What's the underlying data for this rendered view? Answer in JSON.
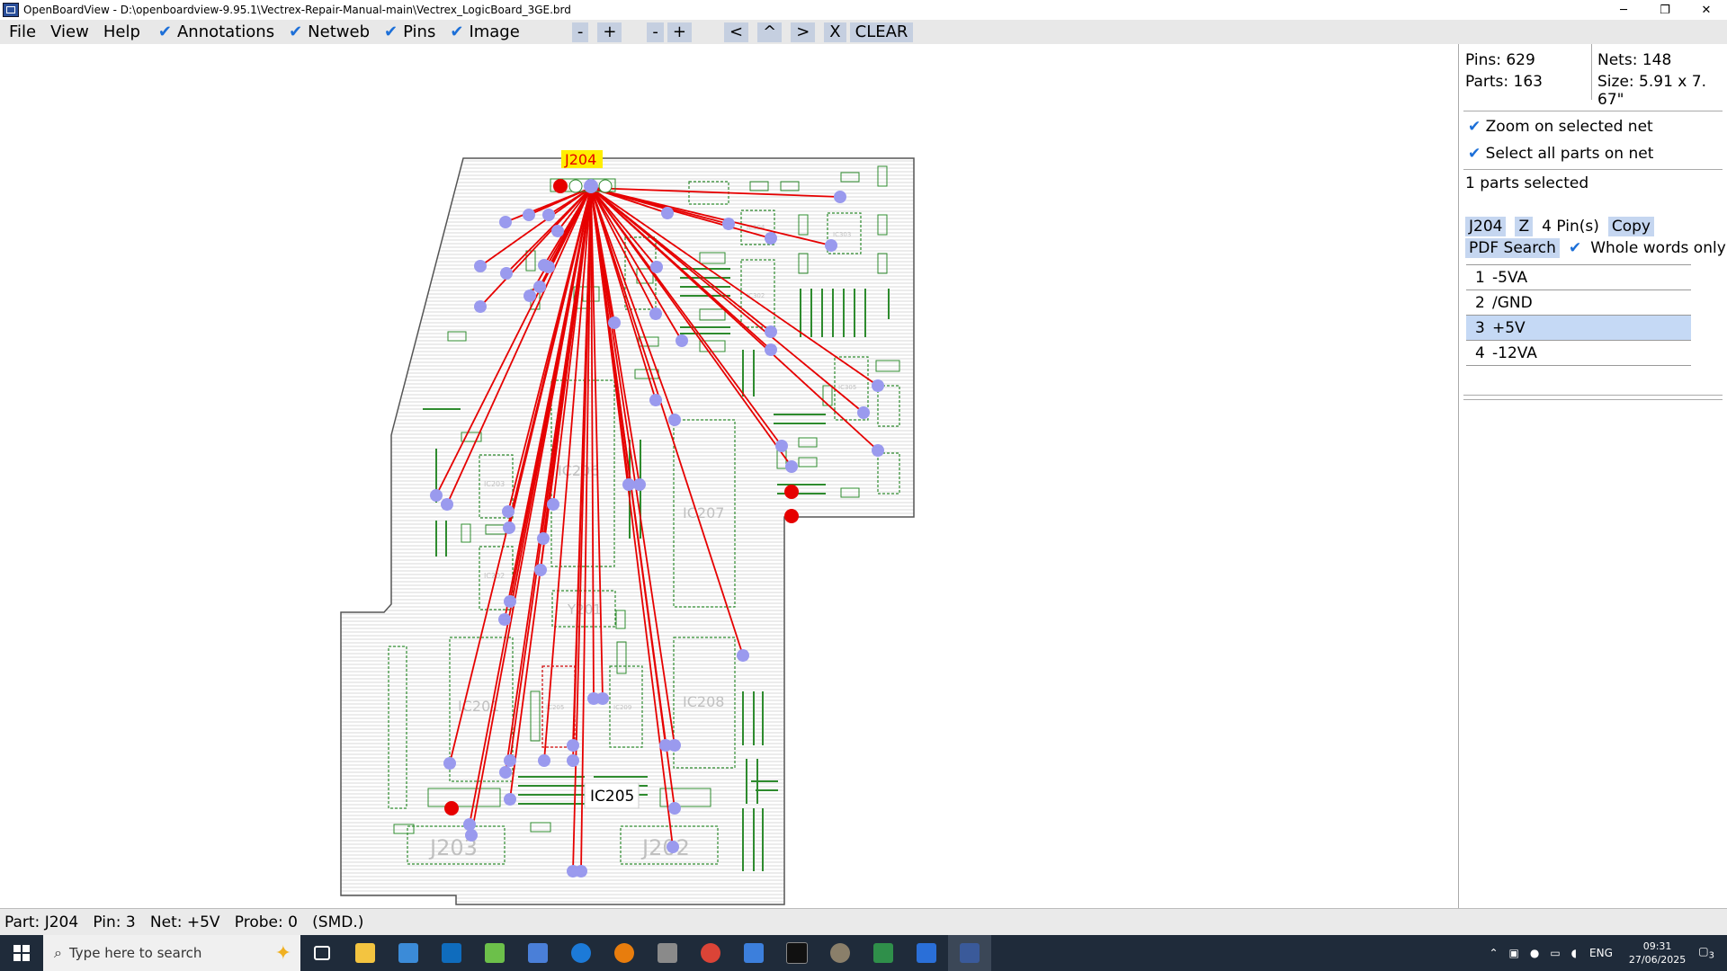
{
  "window": {
    "title": "OpenBoardView - D:\\openboardview-9.95.1\\Vectrex-Repair-Manual-main\\Vectrex_LogicBoard_3GE.brd",
    "minimize_glyph": "─",
    "restore_glyph": "❐",
    "close_glyph": "✕"
  },
  "menu": {
    "file": "File",
    "view": "View",
    "help": "Help",
    "check_glyph": "✔",
    "annotations": "Annotations",
    "netweb": "Netweb",
    "pins": "Pins",
    "image": "Image",
    "zoom_out": "-",
    "zoom_in": "+",
    "rot_minus": "-",
    "rot_plus": "+",
    "nav_left": "<",
    "nav_up": "^",
    "nav_right": ">",
    "nav_x": "X",
    "clear": "CLEAR"
  },
  "panel": {
    "pins": "Pins: 629",
    "nets": "Nets: 148",
    "parts": "Parts: 163",
    "size": "Size: 5.91 x 7.",
    "size2": "67\"",
    "zoom_net": "Zoom on selected net",
    "select_all": "Select all parts on net",
    "selected_count": "1 parts selected",
    "part_name": "J204",
    "z_button": "Z",
    "pin_count": "4 Pin(s)",
    "copy": "Copy",
    "pdf_search": "PDF Search",
    "whole_words": "Whole words only",
    "pin_rows": [
      {
        "num": "1",
        "net": "-5VA"
      },
      {
        "num": "2",
        "net": "/GND"
      },
      {
        "num": "3",
        "net": "+5V"
      },
      {
        "num": "4",
        "net": "-12VA"
      }
    ]
  },
  "board": {
    "selected_label": "J204",
    "hover_label": "IC205",
    "part_labels": [
      "IC206",
      "IC207",
      "IC201",
      "IC208",
      "J203",
      "J202",
      "Y201",
      "IC203",
      "IC202",
      "IC205",
      "IC209",
      "IC305",
      "IC303",
      "IC304",
      "IC302"
    ]
  },
  "status": {
    "text": "Part: J204   Pin: 3   Net: +5V   Probe: 0   (SMD.)"
  },
  "taskbar": {
    "search_placeholder": "Type here to search",
    "lang": "ENG",
    "time": "09:31",
    "date": "27/06/2025",
    "notif_count": "3"
  },
  "colors": {
    "netweb": "#e60000",
    "pin_marker": "#9a9aee",
    "highlight": "#ffee00",
    "part_outline": "#2e8b2e",
    "board_outline": "#555555"
  }
}
